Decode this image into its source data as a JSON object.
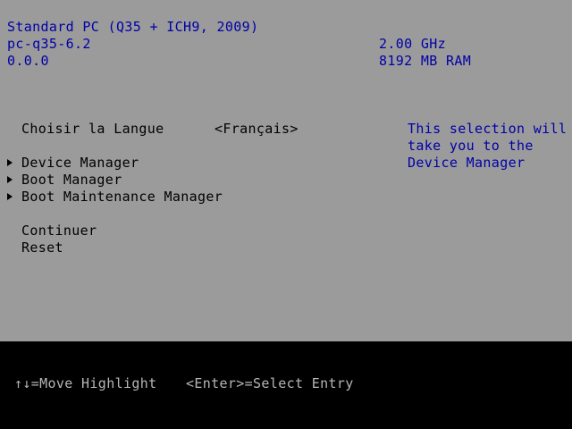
{
  "header": {
    "machine": "Standard PC (Q35 + ICH9, 2009)",
    "model": "pc-q35-6.2",
    "version": "0.0.0",
    "cpu_speed": "2.00 GHz",
    "memory": "8192 MB RAM"
  },
  "menu": {
    "language_label": "Choisir la Langue",
    "language_value": "<Français>",
    "items": [
      {
        "label": "Device Manager",
        "submenu": true
      },
      {
        "label": "Boot Manager",
        "submenu": true
      },
      {
        "label": "Boot Maintenance Manager",
        "submenu": true
      }
    ],
    "continue_label": "Continuer",
    "reset_label": "Reset"
  },
  "help": {
    "lines": [
      "This selection will",
      "take you to the",
      "Device Manager"
    ]
  },
  "footer": {
    "move_hint": "↑↓=Move Highlight",
    "select_hint": "<Enter>=Select Entry"
  },
  "colors": {
    "background": "#9b9b9b",
    "header_text": "#0000a8",
    "menu_text": "#000000",
    "footer_bg": "#000000",
    "footer_text": "#b6b6b6"
  }
}
